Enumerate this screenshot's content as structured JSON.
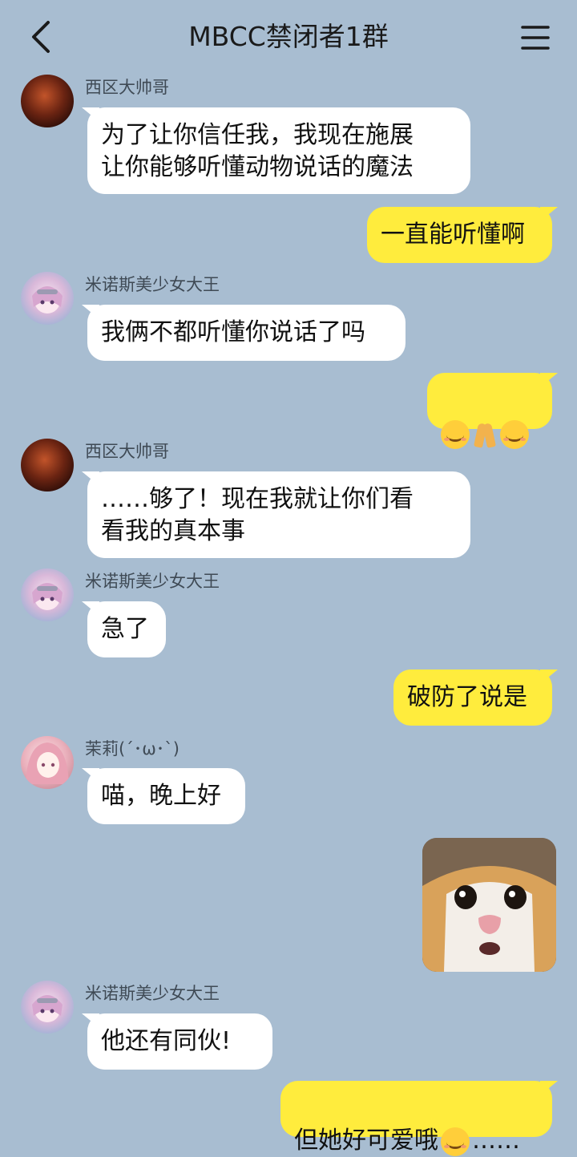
{
  "header": {
    "title": "MBCC禁闭者1群",
    "back_icon": "chevron-left-icon",
    "menu_icon": "hamburger-menu-icon"
  },
  "messages": [
    {
      "sender": "西区大帅哥",
      "text": "为了让你信任我，我现在施展\n让你能够听懂动物说话的魔法",
      "direction": "incoming"
    },
    {
      "text": "一直能听懂啊",
      "direction": "outgoing"
    },
    {
      "sender": "米诺斯美少女大王",
      "text": "我俩不都听懂你说话了吗",
      "direction": "incoming"
    },
    {
      "emoji": [
        "smiling-face-emoji",
        "folded-hands-emoji",
        "smiling-face-emoji"
      ],
      "direction": "outgoing"
    },
    {
      "sender": "西区大帅哥",
      "text": "……够了！现在我就让你们看\n看我的真本事",
      "direction": "incoming"
    },
    {
      "sender": "米诺斯美少女大王",
      "text": "急了",
      "direction": "incoming"
    },
    {
      "text": "破防了说是",
      "direction": "outgoing"
    },
    {
      "sender": "茉莉(´･ω･`)",
      "text": "喵，晚上好",
      "direction": "incoming"
    },
    {
      "image": "surprised-cat-sticker",
      "direction": "outgoing"
    },
    {
      "sender": "米诺斯美少女大王",
      "text": "他还有同伙!",
      "direction": "incoming"
    },
    {
      "text": "但她好可爱哦",
      "text_suffix": "……",
      "emoji": "smiling-face-emoji",
      "direction": "outgoing"
    }
  ],
  "colors": {
    "background": "#a8bdd1",
    "incoming_bubble": "#ffffff",
    "outgoing_bubble": "#ffec3d"
  }
}
